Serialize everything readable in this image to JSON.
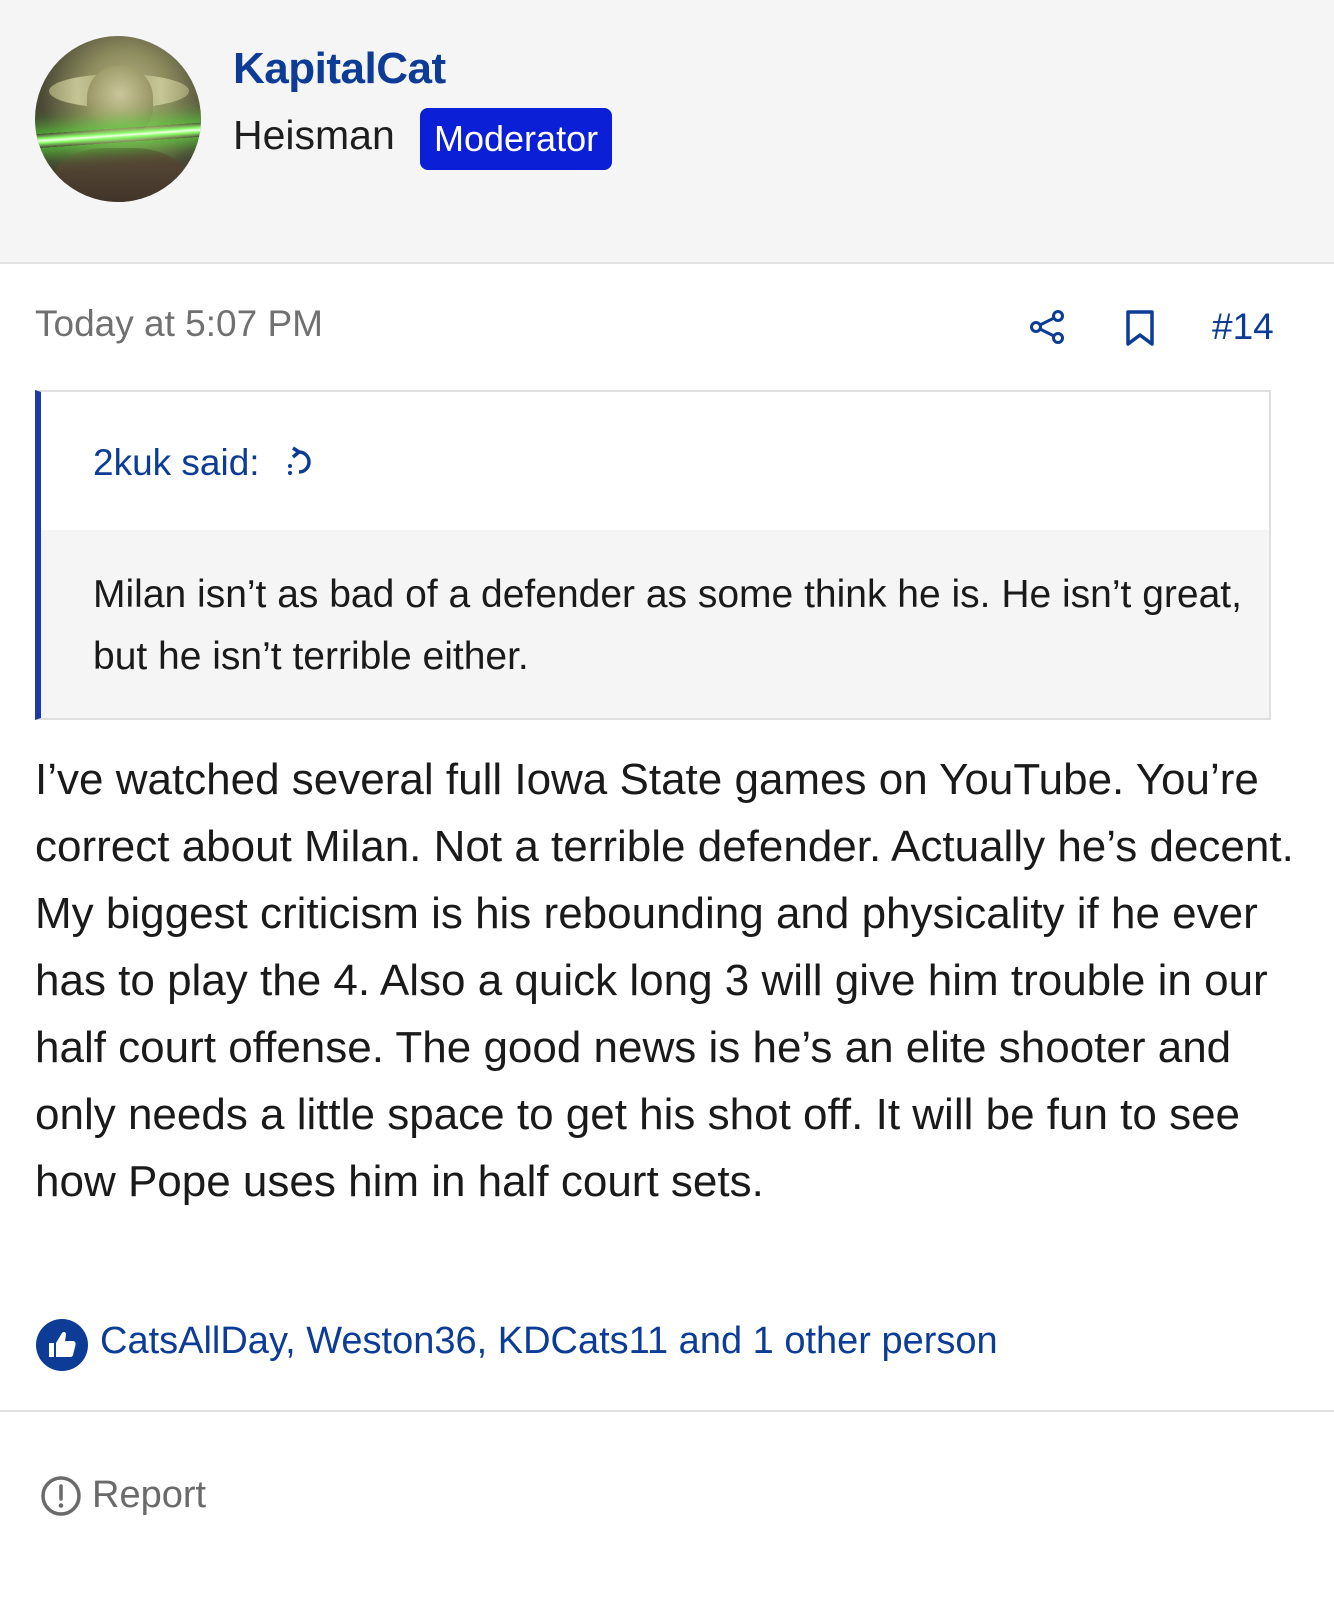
{
  "author": {
    "avatar_icon": "yoda-lightsaber-avatar",
    "username": "KapitalCat",
    "user_title": "Heisman",
    "badge": "Moderator"
  },
  "post": {
    "timestamp": "Today at 5:07 PM",
    "share_icon": "share-icon",
    "bookmark_icon": "bookmark-icon",
    "post_number": "#14"
  },
  "quote": {
    "author_label": "2kuk said:",
    "jump_icon": "jump-to-quote-icon",
    "body": "Milan isn’t as bad of a defender as some think he is. He isn’t great, but he isn’t terrible either."
  },
  "message": {
    "body": "I’ve watched several full Iowa State games on YouTube. You’re correct about Milan. Not a terrible defender. Actually he’s decent. My biggest criticism is his rebounding and physicality if he ever has to play the 4. Also a quick long 3 will give him trouble in our half court offense. The good news is he’s an elite shooter and only needs a little space to get his shot off. It will be fun to see how Pope uses him in half court sets."
  },
  "reactions": {
    "icon": "like-thumbs-up-icon",
    "text": "CatsAllDay, Weston36, KDCats11 and 1 other person"
  },
  "footer": {
    "report_icon": "exclamation-circle-icon",
    "report_label": "Report"
  },
  "colors": {
    "link": "#0c3c96",
    "badge": "#0b20d6",
    "quote_border": "#1c3aa5",
    "header_bg": "#f5f5f5",
    "muted": "#707070"
  }
}
